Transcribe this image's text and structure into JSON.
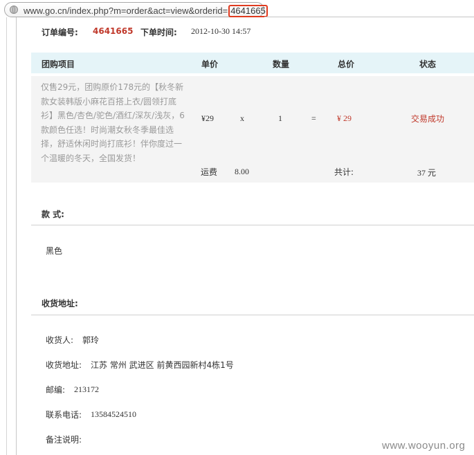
{
  "address_bar": {
    "url_prefix": "www.go.cn/index.php?m=order&act=view&orderid=",
    "url_orderid": "4641665"
  },
  "order": {
    "number_label": "订单编号:",
    "number": "4641665",
    "time_label": "下单时间:",
    "time": "2012-10-30 14:57"
  },
  "table": {
    "headers": {
      "item": "团购项目",
      "unit_price": "单价",
      "quantity": "数量",
      "total": "总价",
      "status": "状态"
    },
    "row": {
      "description": "仅售29元，团购原价178元的【秋冬新款女装韩版小麻花百搭上衣/圆领打底衫】黑色/杏色/驼色/酒红/深灰/浅灰，6款颜色任选！时尚潮女秋冬季最佳选择，舒适休闲时尚打底衫！伴你度过一个温暖的冬天，全国发货！",
      "unit_price": "¥29",
      "times": "x",
      "quantity": "1",
      "equals": "=",
      "total": "¥ 29",
      "status": "交易成功"
    },
    "shipping_label": "运费",
    "shipping_value": "8.00",
    "sum_label": "共计:",
    "sum_value": "37 元"
  },
  "style_section": {
    "title": "款 式:",
    "value": "黑色"
  },
  "address_section": {
    "title": "收货地址:",
    "recipient_label": "收货人:",
    "recipient": "郭玲",
    "address_label": "收货地址:",
    "address": "江苏 常州 武进区 前黄西园新村4栋1号",
    "postcode_label": "邮编:",
    "postcode": "213172",
    "phone_label": "联系电话:",
    "phone": "13584524510",
    "remark_label": "备注说明:"
  },
  "watermark": "www.wooyun.org",
  "colors": {
    "accent_red": "#c0392b",
    "header_bg": "#e5f4f8",
    "highlight_box": "#e03a1f"
  }
}
